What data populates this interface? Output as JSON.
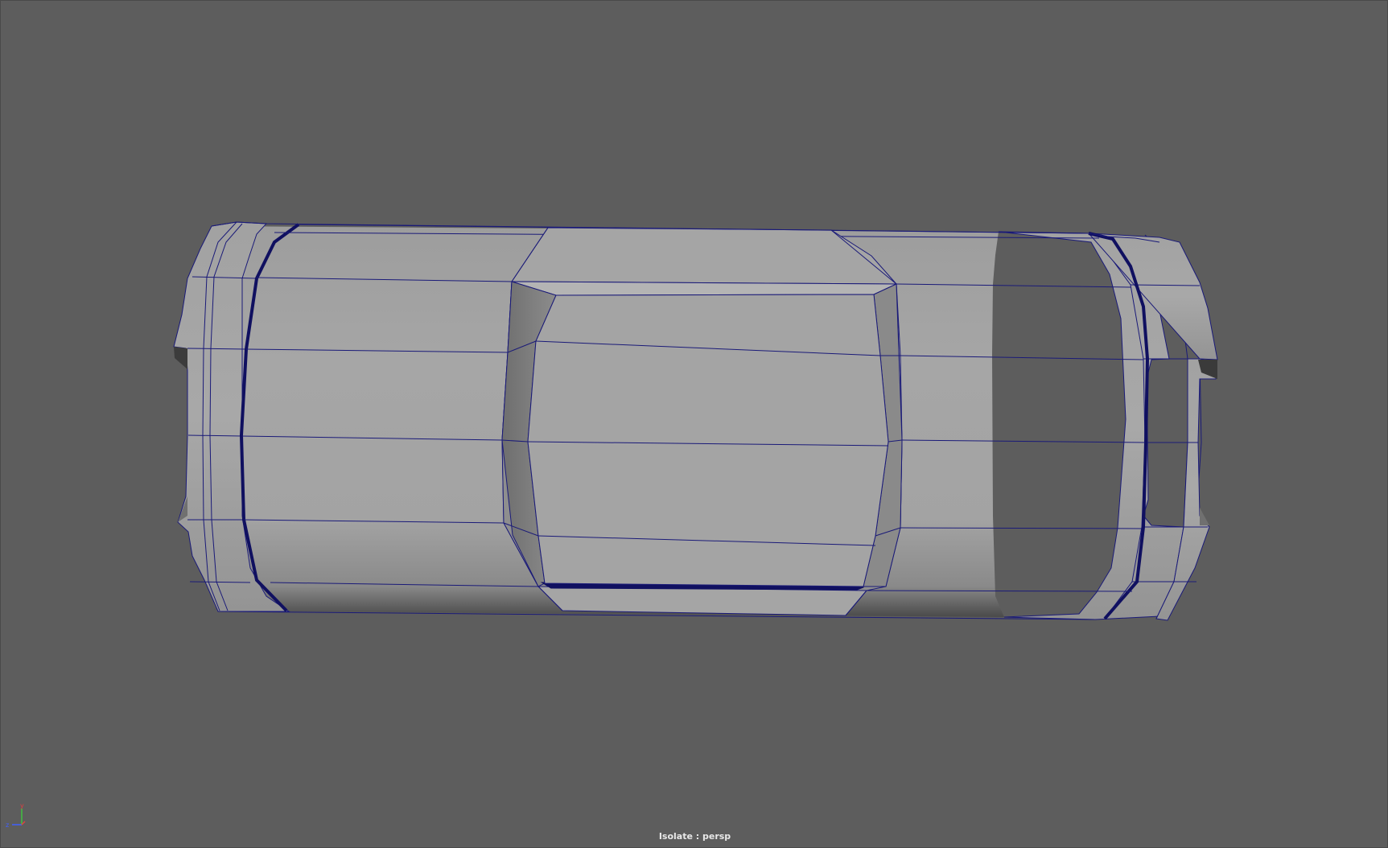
{
  "viewport": {
    "hud_label": "Isolate : persp",
    "camera": "persp",
    "background_color": "#5d5d5d",
    "wireframe_color": "#1a1a78",
    "shaded_surface_color": "#a3a3a3"
  },
  "axis_gizmo": {
    "axes": [
      {
        "name": "y",
        "color": "#e04040"
      },
      {
        "name": "z",
        "color": "#4060ff"
      },
      {
        "name": "x",
        "color": "#40c040"
      }
    ]
  }
}
